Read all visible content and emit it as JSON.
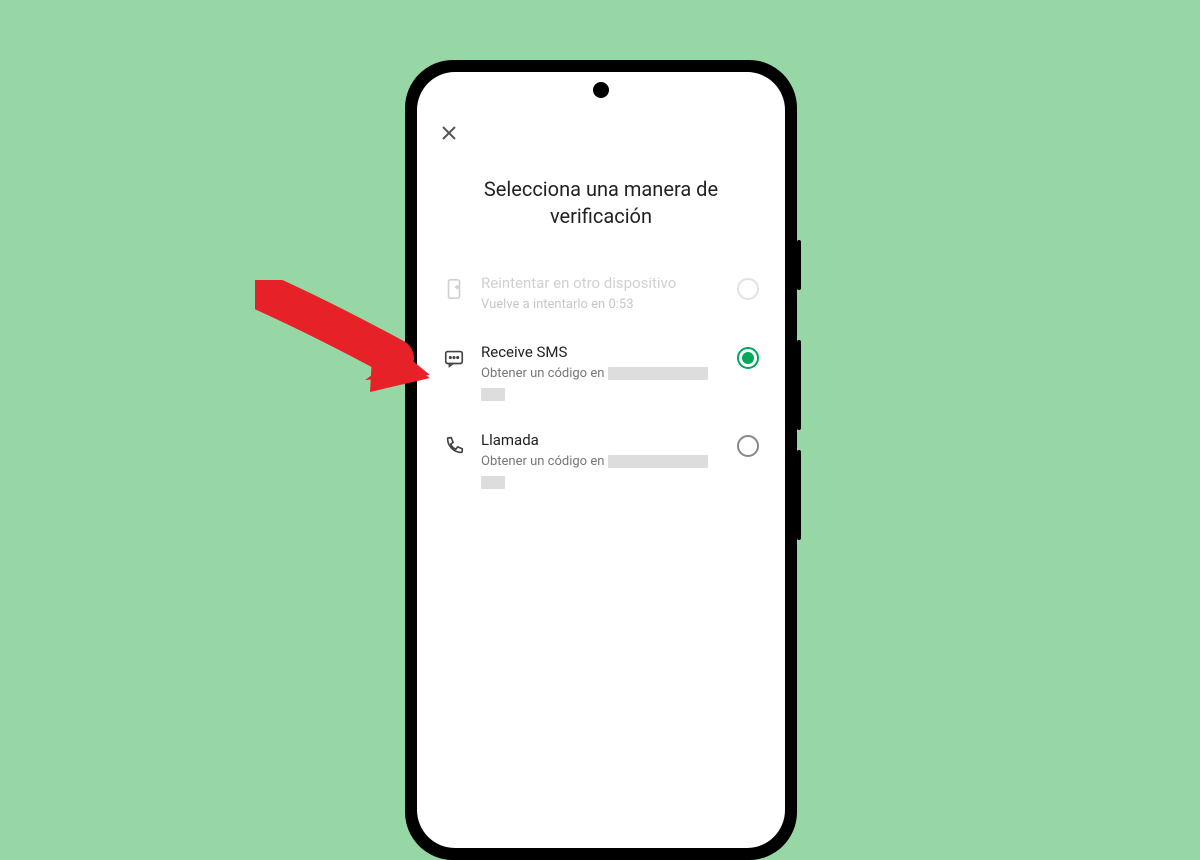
{
  "title": "Selecciona una manera de verificación",
  "options": {
    "retry": {
      "title": "Reintentar en otro dispositivo",
      "subtitle": "Vuelve a intentarlo en 0:53",
      "disabled": true,
      "selected": false
    },
    "sms": {
      "title": "Receive SMS",
      "subtitle_prefix": "Obtener un código en",
      "disabled": false,
      "selected": true
    },
    "call": {
      "title": "Llamada",
      "subtitle_prefix": "Obtener un código en",
      "disabled": false,
      "selected": false
    }
  },
  "colors": {
    "background": "#97d7a5",
    "accent": "#00a859",
    "arrow": "#e62228"
  }
}
